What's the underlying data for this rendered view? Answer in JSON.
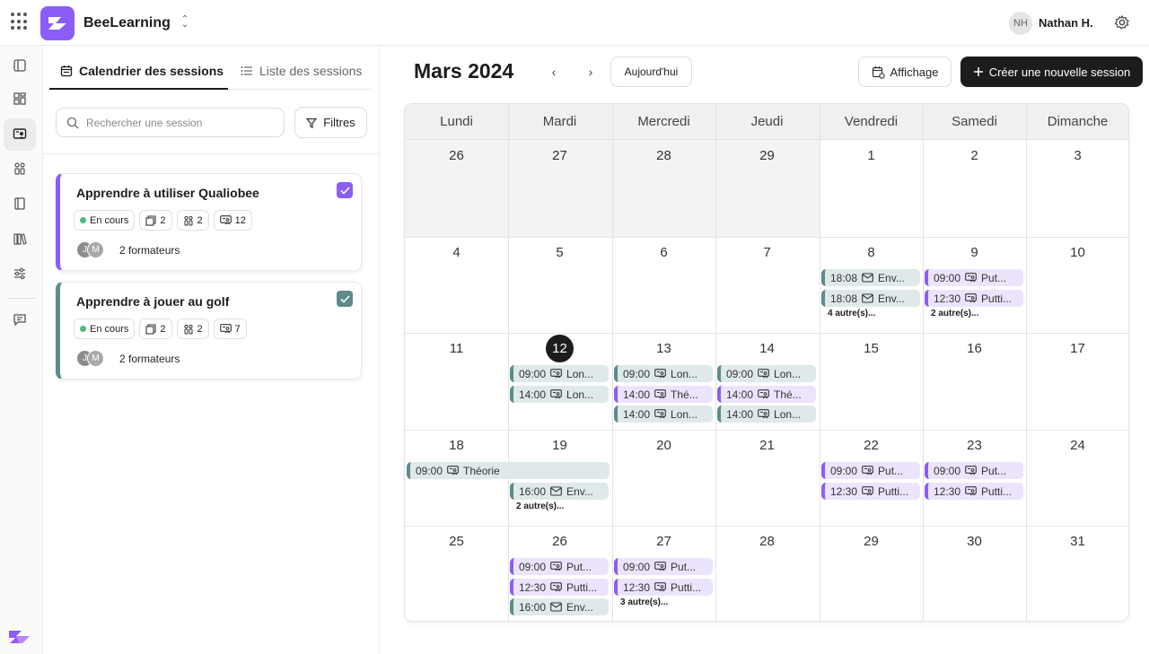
{
  "app": {
    "name": "BeeLearning",
    "user_initials": "NH",
    "user_name": "Nathan H."
  },
  "sidebar": {
    "tabs": [
      {
        "label": "Calendrier des sessions",
        "active": true
      },
      {
        "label": "Liste des sessions",
        "active": false
      }
    ],
    "search_placeholder": "Rechercher une session",
    "filters_label": "Filtres",
    "sessions": [
      {
        "title": "Apprendre à utiliser Qualiobee",
        "status": "En cours",
        "modules": "2",
        "learners": "2",
        "sessions": "12",
        "avatars": [
          "J",
          "M"
        ],
        "trainers": "2 formateurs",
        "color": "#8b5cf6"
      },
      {
        "title": "Apprendre à jouer au golf",
        "status": "En cours",
        "modules": "2",
        "learners": "2",
        "sessions": "7",
        "avatars": [
          "J",
          "M"
        ],
        "trainers": "2 formateurs",
        "color": "#5e8a8a"
      }
    ]
  },
  "calendar": {
    "month_title": "Mars 2024",
    "today_label": "Aujourd'hui",
    "display_label": "Affichage",
    "create_label": "Créer une nouvelle session",
    "weekdays": [
      "Lundi",
      "Mardi",
      "Mercredi",
      "Jeudi",
      "Vendredi",
      "Samedi",
      "Dimanche"
    ],
    "weeks": [
      [
        "26",
        "27",
        "28",
        "29",
        "1",
        "2",
        "3"
      ],
      [
        "4",
        "5",
        "6",
        "7",
        "8",
        "9",
        "10"
      ],
      [
        "11",
        "12",
        "13",
        "14",
        "15",
        "16",
        "17"
      ],
      [
        "18",
        "19",
        "20",
        "21",
        "22",
        "23",
        "24"
      ],
      [
        "25",
        "26",
        "27",
        "28",
        "29",
        "30",
        "31"
      ]
    ],
    "today": {
      "week": 2,
      "day": 1
    },
    "events": [
      {
        "week": 1,
        "day": 4,
        "slot": 0,
        "time": "18:08",
        "icon": "mail",
        "text": "Env...",
        "color": "teal"
      },
      {
        "week": 1,
        "day": 4,
        "slot": 1,
        "time": "18:08",
        "icon": "mail",
        "text": "Env...",
        "color": "teal"
      },
      {
        "week": 1,
        "day": 5,
        "slot": 0,
        "time": "09:00",
        "icon": "session",
        "text": "Put...",
        "color": "purple"
      },
      {
        "week": 1,
        "day": 5,
        "slot": 1,
        "time": "12:30",
        "icon": "session",
        "text": "Putti...",
        "color": "purple"
      },
      {
        "week": 2,
        "day": 1,
        "slot": 0,
        "time": "09:00",
        "icon": "session",
        "text": "Lon...",
        "color": "teal"
      },
      {
        "week": 2,
        "day": 1,
        "slot": 1,
        "time": "14:00",
        "icon": "session",
        "text": "Lon...",
        "color": "teal"
      },
      {
        "week": 2,
        "day": 2,
        "slot": 0,
        "time": "09:00",
        "icon": "session",
        "text": "Lon...",
        "color": "teal"
      },
      {
        "week": 2,
        "day": 2,
        "slot": 1,
        "time": "14:00",
        "icon": "session",
        "text": "Thé...",
        "color": "purple"
      },
      {
        "week": 2,
        "day": 2,
        "slot": 2,
        "time": "14:00",
        "icon": "session",
        "text": "Lon...",
        "color": "teal"
      },
      {
        "week": 2,
        "day": 3,
        "slot": 0,
        "time": "09:00",
        "icon": "session",
        "text": "Lon...",
        "color": "teal"
      },
      {
        "week": 2,
        "day": 3,
        "slot": 1,
        "time": "14:00",
        "icon": "session",
        "text": "Thé...",
        "color": "purple"
      },
      {
        "week": 2,
        "day": 3,
        "slot": 2,
        "time": "14:00",
        "icon": "session",
        "text": "Lon...",
        "color": "teal"
      },
      {
        "week": 3,
        "day": 0,
        "slot": 0,
        "span": 2,
        "time": "09:00",
        "icon": "session",
        "text": "Théorie",
        "color": "teal"
      },
      {
        "week": 3,
        "day": 1,
        "slot": 1,
        "time": "16:00",
        "icon": "mail",
        "text": "Env...",
        "color": "teal"
      },
      {
        "week": 3,
        "day": 4,
        "slot": 0,
        "time": "09:00",
        "icon": "session",
        "text": "Put...",
        "color": "purple"
      },
      {
        "week": 3,
        "day": 4,
        "slot": 1,
        "time": "12:30",
        "icon": "session",
        "text": "Putti...",
        "color": "purple"
      },
      {
        "week": 3,
        "day": 5,
        "slot": 0,
        "time": "09:00",
        "icon": "session",
        "text": "Put...",
        "color": "purple"
      },
      {
        "week": 3,
        "day": 5,
        "slot": 1,
        "time": "12:30",
        "icon": "session",
        "text": "Putti...",
        "color": "purple"
      },
      {
        "week": 4,
        "day": 1,
        "slot": 0,
        "time": "09:00",
        "icon": "session",
        "text": "Put...",
        "color": "purple"
      },
      {
        "week": 4,
        "day": 1,
        "slot": 1,
        "time": "12:30",
        "icon": "session",
        "text": "Putti...",
        "color": "purple"
      },
      {
        "week": 4,
        "day": 1,
        "slot": 2,
        "time": "16:00",
        "icon": "mail",
        "text": "Env...",
        "color": "teal"
      },
      {
        "week": 4,
        "day": 2,
        "slot": 0,
        "time": "09:00",
        "icon": "session",
        "text": "Put...",
        "color": "purple"
      },
      {
        "week": 4,
        "day": 2,
        "slot": 1,
        "time": "12:30",
        "icon": "session",
        "text": "Putti...",
        "color": "purple"
      }
    ],
    "more": [
      {
        "week": 1,
        "day": 4,
        "slot": 2,
        "text": "4 autre(s)..."
      },
      {
        "week": 1,
        "day": 5,
        "slot": 2,
        "text": "2 autre(s)..."
      },
      {
        "week": 3,
        "day": 1,
        "slot": 2,
        "text": "2 autre(s)..."
      },
      {
        "week": 4,
        "day": 2,
        "slot": 2,
        "text": "3 autre(s)..."
      }
    ]
  },
  "colors": {
    "accent": "#8b5cf6",
    "teal": "#5e8a8a",
    "dark": "#1c1c1c"
  }
}
